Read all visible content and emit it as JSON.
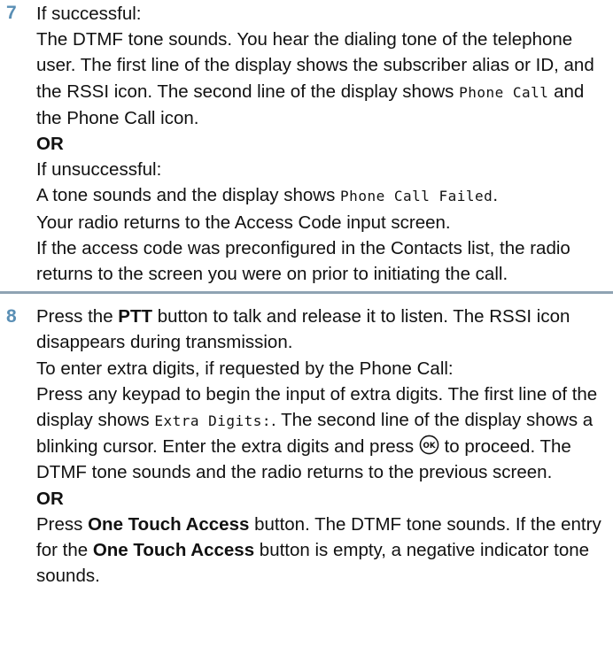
{
  "accent_color": "#5a8fb5",
  "divider_color": "#8fa3b3",
  "step7": {
    "number": "7",
    "if_successful": "If successful:",
    "success_a": "The DTMF tone sounds. You hear the dialing tone of the telephone user. The first line of the display shows the subscriber alias or ID, and the RSSI icon. The second line of the display shows ",
    "success_mono": "Phone Call",
    "success_b": " and the Phone Call icon.",
    "or": "OR",
    "if_unsuccessful": "If unsuccessful:",
    "fail_a": "A tone sounds and the display shows ",
    "fail_mono": "Phone Call Failed",
    "fail_b": ".",
    "fail_line2": "Your radio returns to the Access Code input screen.",
    "fail_line3": "If the access code was preconfigured in the Contacts list, the radio returns to the screen you were on prior to initiating the call."
  },
  "step8": {
    "number": "8",
    "press_a": "Press the ",
    "ptt": "PTT",
    "press_b": " button to talk and release it to listen. The RSSI icon disappears during transmission.",
    "extra_intro": "To enter extra digits, if requested by the Phone Call:",
    "extra_a": "Press any keypad to begin the input of extra digits. The first line of the display shows ",
    "extra_mono": "Extra Digits:",
    "extra_b": ". The second line of the display shows a blinking cursor. Enter the extra digits and press ",
    "ok_icon": "ok-button-icon",
    "ok_icon_text": "OK",
    "extra_c": " to proceed. The DTMF tone sounds and the radio returns to the previous screen.",
    "or": "OR",
    "ota_a": "Press ",
    "ota_bold1": "One Touch Access",
    "ota_b": " button. The DTMF tone sounds. If the entry for the ",
    "ota_bold2": "One Touch Access",
    "ota_c": " button is empty, a negative indicator tone sounds."
  }
}
